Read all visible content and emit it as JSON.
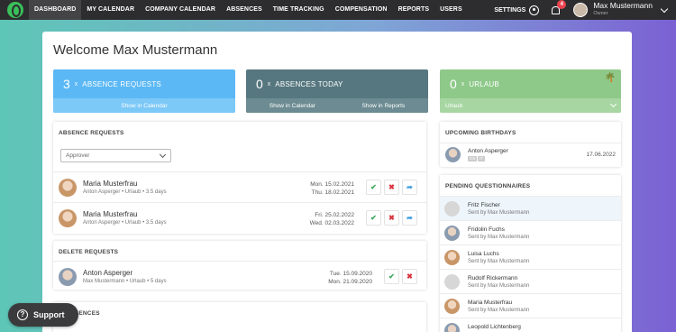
{
  "nav": {
    "items": [
      "DASHBOARD",
      "MY CALENDAR",
      "COMPANY CALENDAR",
      "ABSENCES",
      "TIME TRACKING",
      "COMPENSATION",
      "REPORTS",
      "USERS"
    ],
    "settings": "SETTINGS",
    "notification_count": "4",
    "user_name": "Max Mustermann",
    "user_role": "Owner"
  },
  "welcome": "Welcome Max Mustermann",
  "tiles": [
    {
      "num": "3",
      "x": "x",
      "label": "ABSENCE REQUESTS",
      "links": [
        "Show in Calendar"
      ],
      "color": "#5bb8f5"
    },
    {
      "num": "0",
      "x": "x",
      "label": "ABSENCES TODAY",
      "links": [
        "Show in Calendar",
        "Show in Reports"
      ],
      "color": "#56777f"
    },
    {
      "num": "0",
      "x": "x",
      "label": "URLAUB",
      "links": [
        "Urlaub"
      ],
      "color": "#8fc98a"
    }
  ],
  "absence_requests": {
    "title": "ABSENCE REQUESTS",
    "filter": "Approver",
    "rows": [
      {
        "name": "Maria Musterfrau",
        "sub": "Anton Asperger • Urlaub • 3.5 days",
        "from": "Mon. 15.02.2021",
        "to": "Thu. 18.02.2021"
      },
      {
        "name": "Maria Musterfrau",
        "sub": "Anton Asperger • Urlaub • 3.5 days",
        "from": "Fri. 25.02.2022",
        "to": "Wed. 02.03.2022"
      }
    ]
  },
  "delete_requests": {
    "title": "DELETE REQUESTS",
    "rows": [
      {
        "name": "Anton Asperger",
        "sub": "Max Mustermann • Urlaub • 5 days",
        "from": "Tue. 15.09.2020",
        "to": "Mon. 21.09.2020"
      }
    ]
  },
  "absences_today": {
    "title": "'S ABSENCES"
  },
  "birthdays": {
    "title": "UPCOMING BIRTHDAYS",
    "rows": [
      {
        "name": "Anton Asperger",
        "tags": [
          "CS",
          "IT"
        ],
        "date": "17.06.2022"
      }
    ]
  },
  "questionnaires": {
    "title": "PENDING QUESTIONNAIRES",
    "rows": [
      {
        "name": "Fritz Fischer",
        "sub": "Sent by Max Mustermann"
      },
      {
        "name": "Fridolin Fuchs",
        "sub": "Sent by Max Mustermann"
      },
      {
        "name": "Luisa Luchs",
        "sub": "Sent by Max Mustermann"
      },
      {
        "name": "Rudolf Rickermann",
        "sub": "Sent by Max Mustermann"
      },
      {
        "name": "Maria Musterfrau",
        "sub": "Sent by Max Mustermann"
      },
      {
        "name": "Leopold Lichtenberg",
        "sub": ""
      }
    ]
  },
  "support": "Support"
}
